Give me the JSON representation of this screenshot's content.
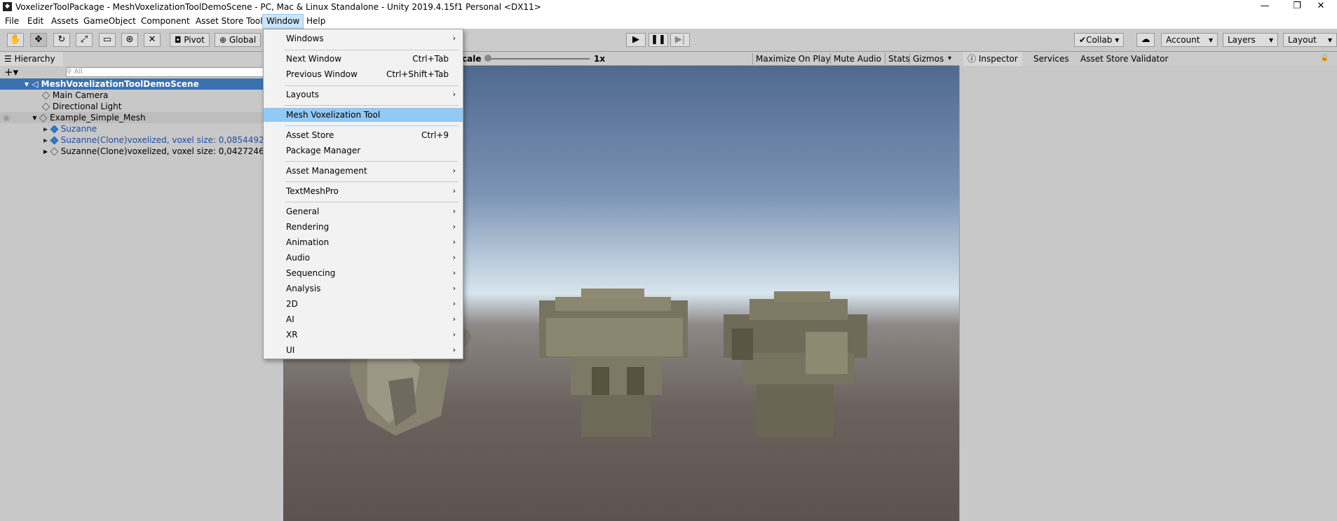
{
  "window": {
    "title": "VoxelizerToolPackage - MeshVoxelizationToolDemoScene - PC, Mac & Linux Standalone - Unity 2019.4.15f1 Personal <DX11>",
    "minimize": "—",
    "maximize": "❐",
    "close": "✕"
  },
  "menubar": [
    "File",
    "Edit",
    "Assets",
    "GameObject",
    "Component",
    "Asset Store Tools",
    "Window",
    "Help"
  ],
  "toolbar": {
    "pivot": "Pivot",
    "global": "Global",
    "collab": "Collab",
    "account": "Account",
    "layers": "Layers",
    "layout": "Layout"
  },
  "hierarchy": {
    "tab": "Hierarchy",
    "search_placeholder": "All",
    "scene": "MeshVoxelizationToolDemoScene",
    "items": [
      "Main Camera",
      "Directional Light",
      "Example_Simple_Mesh",
      "Suzanne",
      "Suzanne(Clone)voxelized, voxel size: 0,08544925",
      "Suzanne(Clone)voxelized, voxel size: 0,04272462"
    ]
  },
  "game_bar": {
    "scale_label": "cale",
    "scale_value": "1x",
    "maximize": "Maximize On Play",
    "mute": "Mute Audio",
    "stats": "Stats",
    "gizmos": "Gizmos"
  },
  "inspector": {
    "tabs": [
      "Inspector",
      "Services",
      "Asset Store Validator"
    ]
  },
  "window_menu": {
    "items": [
      {
        "label": "Windows",
        "submenu": true
      },
      {
        "label": "Next Window",
        "shortcut": "Ctrl+Tab"
      },
      {
        "label": "Previous Window",
        "shortcut": "Ctrl+Shift+Tab"
      },
      {
        "label": "Layouts",
        "submenu": true
      },
      {
        "label": "Mesh Voxelization Tool",
        "highlighted": true
      },
      {
        "label": "Asset Store",
        "shortcut": "Ctrl+9"
      },
      {
        "label": "Package Manager"
      },
      {
        "label": "Asset Management",
        "submenu": true
      },
      {
        "label": "TextMeshPro",
        "submenu": true
      },
      {
        "label": "General",
        "submenu": true
      },
      {
        "label": "Rendering",
        "submenu": true
      },
      {
        "label": "Animation",
        "submenu": true
      },
      {
        "label": "Audio",
        "submenu": true
      },
      {
        "label": "Sequencing",
        "submenu": true
      },
      {
        "label": "Analysis",
        "submenu": true
      },
      {
        "label": "2D",
        "submenu": true
      },
      {
        "label": "AI",
        "submenu": true
      },
      {
        "label": "XR",
        "submenu": true
      },
      {
        "label": "UI",
        "submenu": true
      }
    ]
  }
}
